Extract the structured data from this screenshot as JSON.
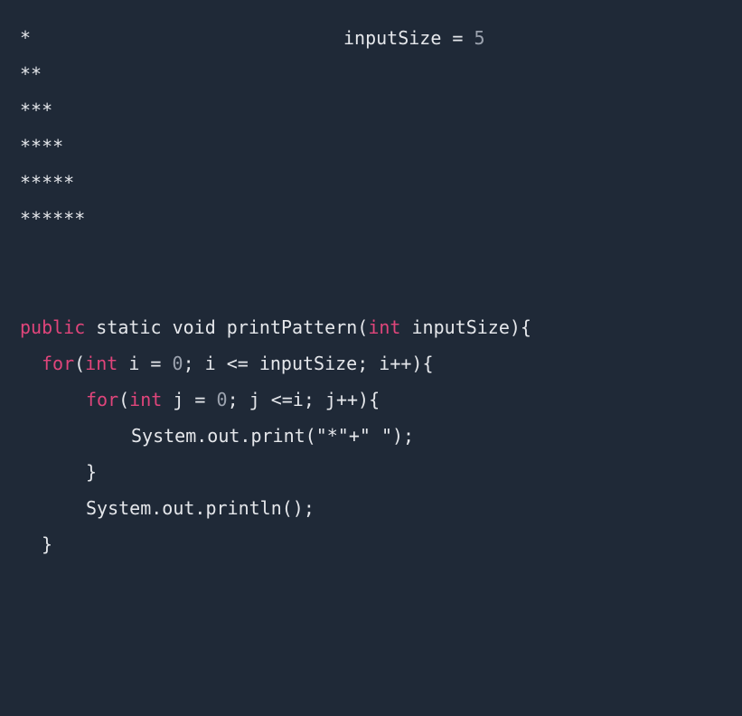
{
  "colors": {
    "background": "#1f2937",
    "text": "#e5e7eb",
    "keyword": "#e0457b",
    "number": "#9ca3af"
  },
  "output": {
    "rows": [
      "*",
      "**",
      "***",
      "****",
      "*****",
      "******"
    ],
    "input_label": "inputSize = ",
    "input_value": "5"
  },
  "code": {
    "l1": {
      "k1": "public",
      "t1": " static void printPattern(",
      "k2": "int",
      "t2": " inputSize){"
    },
    "l2": {
      "k1": "for",
      "t1": "(",
      "k2": "int",
      "t2": " i = ",
      "n1": "0",
      "t3": "; i <= inputSize; i++){"
    },
    "l3": {
      "k1": "for",
      "t1": "(",
      "k2": "int",
      "t2": " j = ",
      "n1": "0",
      "t3": "; j <=i; j++){"
    },
    "l4": {
      "t1": "System.out.print(\"*\"+\" \");"
    },
    "l5": {
      "t1": "}"
    },
    "l6": {
      "t1": "System.out.println();"
    },
    "l7": {
      "t1": "}"
    }
  }
}
